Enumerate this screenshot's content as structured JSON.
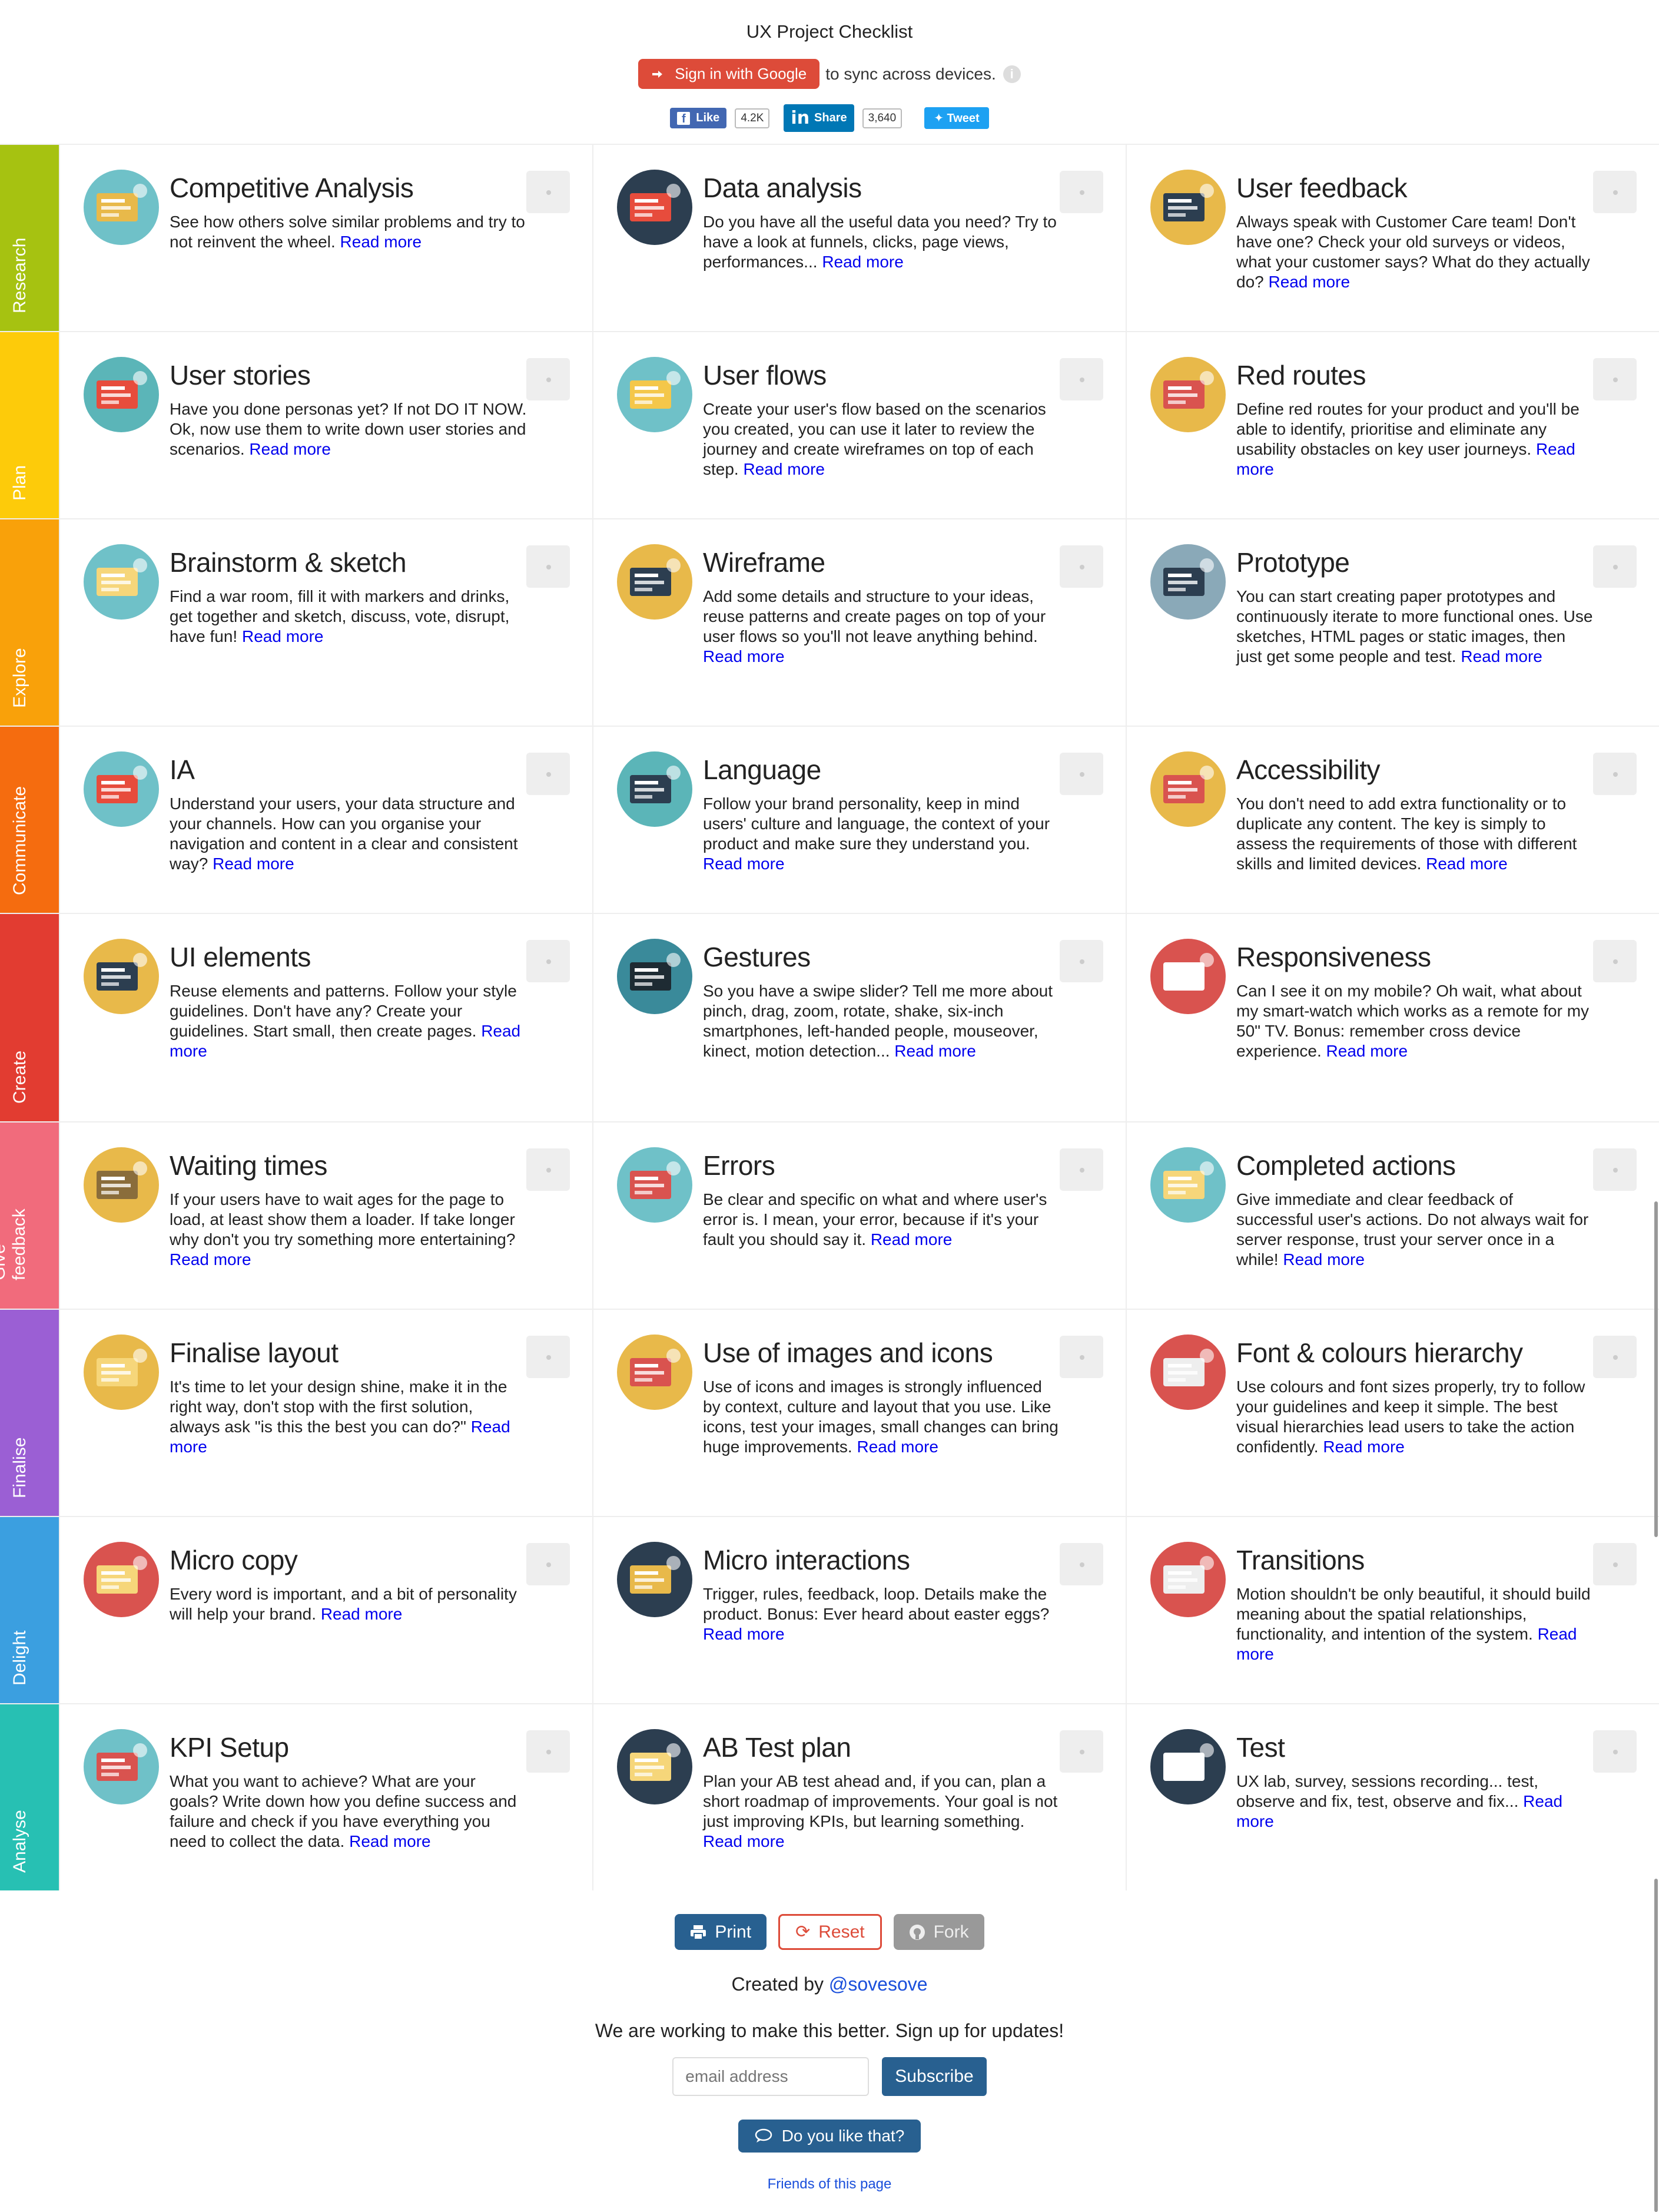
{
  "header": {
    "title": "UX Project Checklist",
    "signin_label": "Sign in with Google",
    "sync_text": "to sync across devices.",
    "info_icon": "i",
    "fb_like": "Like",
    "fb_count": "4.2K",
    "li_share": "Share",
    "li_count": "3,640",
    "tweet": "Tweet"
  },
  "colors": {
    "research": "#a6c211",
    "plan": "#fdcb0a",
    "explore": "#f9a10a",
    "communicate": "#f56c0f",
    "create": "#e23c31",
    "give_feedback": "#f16b7c",
    "finalise": "#9b5fd4",
    "delight": "#3b9fe0",
    "analyse": "#27c0b3"
  },
  "read_more": "Read more",
  "rows": [
    {
      "stage": "Research",
      "cards": [
        {
          "title": "Competitive Analysis",
          "text": "See how others solve similar problems and try to not reinvent the wheel."
        },
        {
          "title": "Data analysis",
          "text": "Do you have all the useful data you need? Try to have a look at funnels, clicks, page views, performances..."
        },
        {
          "title": "User feedback",
          "text": "Always speak with Customer Care team! Don't have one? Check your old surveys or videos, what your customer says? What do they actually do?"
        }
      ]
    },
    {
      "stage": "Plan",
      "cards": [
        {
          "title": "User stories",
          "text": "Have you done personas yet? If not DO IT NOW. Ok, now use them to write down user stories and scenarios."
        },
        {
          "title": "User flows",
          "text": "Create your user's flow based on the scenarios you created, you can use it later to review the journey and create wireframes on top of each step."
        },
        {
          "title": "Red routes",
          "text": "Define red routes for your product and you'll be able to identify, prioritise and eliminate any usability obstacles on key user journeys."
        }
      ]
    },
    {
      "stage": "Explore",
      "cards": [
        {
          "title": "Brainstorm & sketch",
          "text": "Find a war room, fill it with markers and drinks, get together and sketch, discuss, vote, disrupt, have fun!"
        },
        {
          "title": "Wireframe",
          "text": "Add some details and structure to your ideas, reuse patterns and create pages on top of your user flows so you'll not leave anything behind."
        },
        {
          "title": "Prototype",
          "text": "You can start creating paper prototypes and continuously iterate to more functional ones. Use sketches, HTML pages or static images, then just get some people and test."
        }
      ]
    },
    {
      "stage": "Communicate",
      "cards": [
        {
          "title": "IA",
          "text": "Understand your users, your data structure and your channels. How can you organise your navigation and content in a clear and consistent way?"
        },
        {
          "title": "Language",
          "text": "Follow your brand personality, keep in mind users' culture and language, the context of your product and make sure they understand you."
        },
        {
          "title": "Accessibility",
          "text": "You don't need to add extra functionality or to duplicate any content. The key is simply to assess the requirements of those with different skills and limited devices."
        }
      ]
    },
    {
      "stage": "Create",
      "cards": [
        {
          "title": "UI elements",
          "text": "Reuse elements and patterns. Follow your style guidelines. Don't have any? Create your guidelines. Start small, then create pages."
        },
        {
          "title": "Gestures",
          "text": "So you have a swipe slider? Tell me more about pinch, drag, zoom, rotate, shake, six-inch smartphones, left-handed people, mouseover, kinect, motion detection..."
        },
        {
          "title": "Responsiveness",
          "text": "Can I see it on my mobile? Oh wait, what about my smart-watch which works as a remote for my 50\" TV. Bonus: remember cross device experience."
        }
      ]
    },
    {
      "stage": "Give feedback",
      "cards": [
        {
          "title": "Waiting times",
          "text": "If your users have to wait ages for the page to load, at least show them a loader. If take longer why don't you try something more entertaining?"
        },
        {
          "title": "Errors",
          "text": "Be clear and specific on what and where user's error is. I mean, your error, because if it's your fault you should say it."
        },
        {
          "title": "Completed actions",
          "text": "Give immediate and clear feedback of successful user's actions. Do not always wait for server response, trust your server once in a while!"
        }
      ]
    },
    {
      "stage": "Finalise",
      "cards": [
        {
          "title": "Finalise layout",
          "text": "It's time to let your design shine, make it in the right way, don't stop with the first solution, always ask \"is this the best you can do?\""
        },
        {
          "title": "Use of images and icons",
          "text": "Use of icons and images is strongly influenced by context, culture and layout that you use. Like icons, test your images, small changes can bring huge improvements."
        },
        {
          "title": "Font & colours hierarchy",
          "text": "Use colours and font sizes properly, try to follow your guidelines and keep it simple. The best visual hierarchies lead users to take the action confidently."
        }
      ]
    },
    {
      "stage": "Delight",
      "cards": [
        {
          "title": "Micro copy",
          "text": "Every word is important, and a bit of personality will help your brand."
        },
        {
          "title": "Micro interactions",
          "text": "Trigger, rules, feedback, loop. Details make the product. Bonus: Ever heard about easter eggs?"
        },
        {
          "title": "Transitions",
          "text": "Motion shouldn't be only beautiful, it should build meaning about the spatial relationships, functionality, and intention of the system."
        }
      ]
    },
    {
      "stage": "Analyse",
      "cards": [
        {
          "title": "KPI Setup",
          "text": "What you want to achieve? What are your goals? Write down how you define success and failure and check if you have everything you need to collect the data."
        },
        {
          "title": "AB Test plan",
          "text": "Plan your AB test ahead and, if you can, plan a short roadmap of improvements. Your goal is not just improving KPIs, but learning something."
        },
        {
          "title": "Test",
          "text": "UX lab, survey, sessions recording... test, observe and fix, test, observe and fix..."
        }
      ]
    }
  ],
  "footer": {
    "print": "Print",
    "reset": "Reset",
    "fork": "Fork",
    "created_by": "Created by",
    "author": "@sovesove",
    "working": "We are working to make this better. Sign up for updates!",
    "email_placeholder": "email address",
    "subscribe": "Subscribe",
    "like": "Do you like that?",
    "friends": "Friends of this page"
  }
}
